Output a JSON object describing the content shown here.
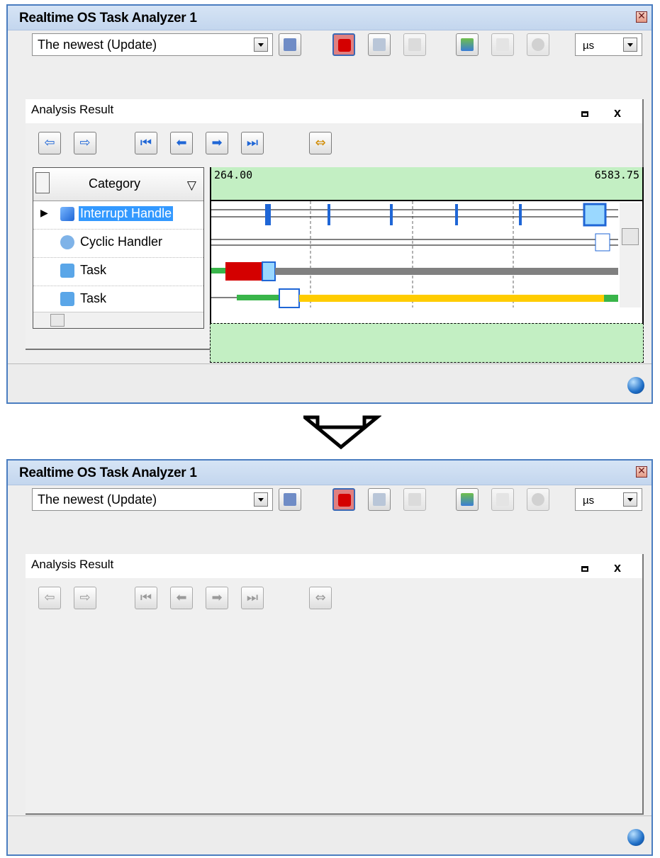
{
  "window_title": "Realtime OS Task Analyzer 1",
  "toolbar": {
    "mode_selected": "The newest (Update)",
    "unit_selected": "µs"
  },
  "panel": {
    "title": "Analysis Result",
    "category_header": "Category",
    "rows": [
      {
        "label": "Interrupt Handle"
      },
      {
        "label": "Cyclic Handler"
      },
      {
        "label": "Task"
      },
      {
        "label": "Task"
      }
    ],
    "range_start": "264.00",
    "range_end": "6583.75"
  },
  "icons": {
    "close": "close-icon",
    "save": "save-icon",
    "record": "record-icon",
    "filter": "filter-icon"
  },
  "colors": {
    "title_bg": "#c3d6ee",
    "range_bg": "#c3efc3",
    "interrupt": "#1f66d6",
    "task_run": "#39b54a",
    "task_wait": "#ffcc00",
    "task_gray": "#808080"
  }
}
